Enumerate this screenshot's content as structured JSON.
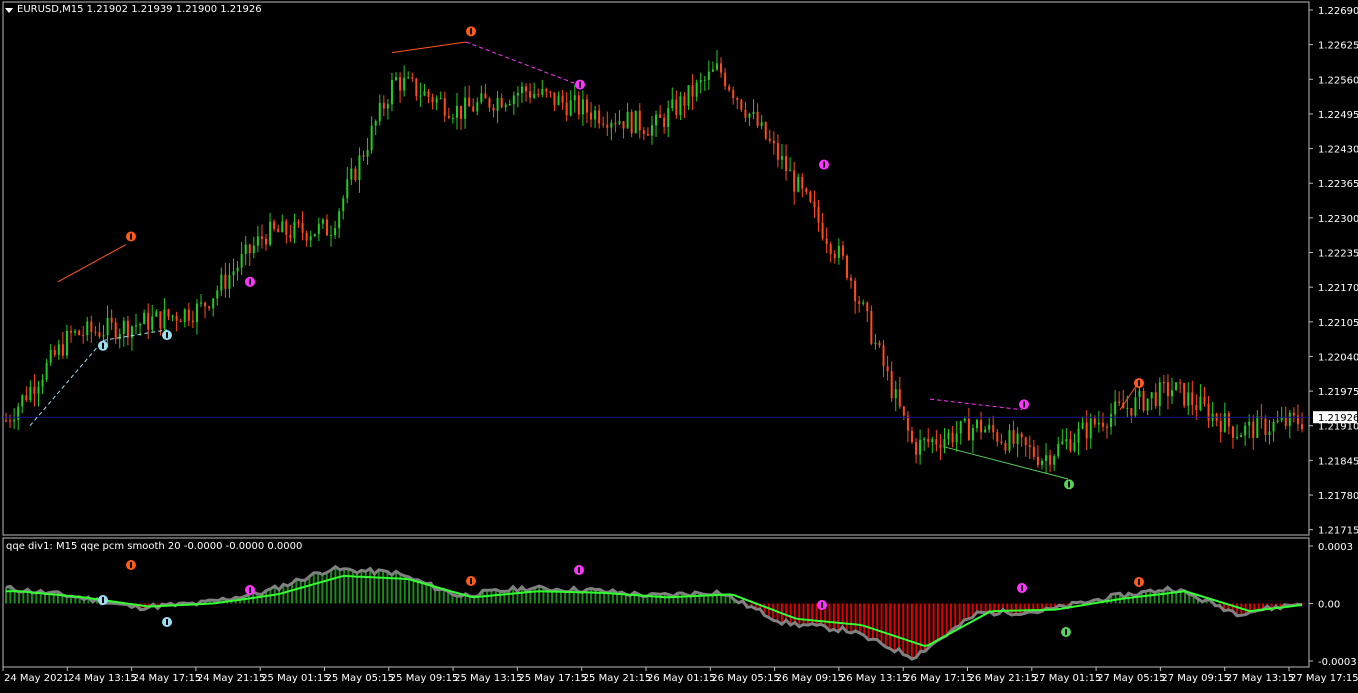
{
  "window": {
    "symbol_title": "EURUSD,M15  1.21902 1.21939 1.21900 1.21926",
    "menu_icon": "triangle-down-icon"
  },
  "price_axis": {
    "ticks": [
      "1.22690",
      "1.22625",
      "1.22560",
      "1.22495",
      "1.22430",
      "1.22365",
      "1.22300",
      "1.22235",
      "1.22170",
      "1.22105",
      "1.22040",
      "1.21975",
      "1.21910",
      "1.21845",
      "1.21780",
      "1.21715"
    ],
    "current_price_label": "1.21926",
    "current_price": 1.21926,
    "ylim": [
      1.21705,
      1.22705
    ]
  },
  "indicator": {
    "title": "qqe div1: M15 qqe pcm smooth  20 -0.0000 -0.0000 0.0000",
    "axis_ticks": [
      "0.0003",
      "0.00",
      "-0.0003"
    ]
  },
  "time_axis": {
    "labels": [
      "24 May 2021",
      "24 May 13:15",
      "24 May 17:15",
      "24 May 21:15",
      "25 May 01:15",
      "25 May 05:15",
      "25 May 09:15",
      "25 May 13:15",
      "25 May 17:15",
      "25 May 21:15",
      "26 May 01:15",
      "26 May 05:15",
      "26 May 09:15",
      "26 May 13:15",
      "26 May 17:15",
      "26 May 21:15",
      "27 May 01:15",
      "27 May 05:15",
      "27 May 09:15",
      "27 May 13:15",
      "27 May 17:15"
    ]
  },
  "colors": {
    "background": "#000000",
    "bull": "#22cc22",
    "bear": "#ff4a1a",
    "price_line": "#1a1a8c",
    "qqe_fast": "#33ff33",
    "qqe_slow": "#808080",
    "hist_pos": "#1a8a1a",
    "hist_neg": "#e00000",
    "div_bear": "#ff5a1a",
    "div_bear_hidden": "#ff33ff",
    "div_bull": "#5ad05a",
    "div_bull_hidden": "#9adcf0"
  },
  "chart_data": [
    {
      "type": "candlestick",
      "title": "EURUSD,M15",
      "ylim": [
        1.21705,
        1.22705
      ],
      "approximate_close_path": [
        {
          "x": "24 May 2021",
          "y": 1.2192
        },
        {
          "x": "24 May 13:15",
          "y": 1.2208
        },
        {
          "x": "24 May 17:15",
          "y": 1.221
        },
        {
          "x": "24 May 21:15",
          "y": 1.2213
        },
        {
          "x": "25 May 01:15",
          "y": 1.2227
        },
        {
          "x": "25 May 05:15",
          "y": 1.2228
        },
        {
          "x": "25 May 09:15",
          "y": 1.2256
        },
        {
          "x": "25 May 13:15",
          "y": 1.225
        },
        {
          "x": "25 May 17:15",
          "y": 1.2254
        },
        {
          "x": "25 May 21:15",
          "y": 1.225
        },
        {
          "x": "26 May 01:15",
          "y": 1.2247
        },
        {
          "x": "26 May 05:15",
          "y": 1.2258
        },
        {
          "x": "26 May 09:15",
          "y": 1.224
        },
        {
          "x": "26 May 13:15",
          "y": 1.222
        },
        {
          "x": "26 May 17:15",
          "y": 1.2187
        },
        {
          "x": "26 May 21:15",
          "y": 1.2191
        },
        {
          "x": "27 May 01:15",
          "y": 1.2185
        },
        {
          "x": "27 May 05:15",
          "y": 1.2193
        },
        {
          "x": "27 May 09:15",
          "y": 1.2198
        },
        {
          "x": "27 May 13:15",
          "y": 1.219
        },
        {
          "x": "27 May 17:15",
          "y": 1.2192
        }
      ]
    },
    {
      "type": "area",
      "title": "qqe div1: M15 qqe pcm smooth  20 -0.0000 -0.0000 0.0000",
      "ylim": [
        -0.0003,
        0.0003
      ],
      "approximate_values": [
        {
          "x": "24 May 2021",
          "y": 8e-05
        },
        {
          "x": "24 May 13:15",
          "y": 4e-05
        },
        {
          "x": "24 May 17:15",
          "y": -2e-05
        },
        {
          "x": "24 May 21:15",
          "y": 0.0
        },
        {
          "x": "25 May 01:15",
          "y": 6e-05
        },
        {
          "x": "25 May 05:15",
          "y": 0.00018
        },
        {
          "x": "25 May 09:15",
          "y": 0.00016
        },
        {
          "x": "25 May 13:15",
          "y": 4e-05
        },
        {
          "x": "25 May 17:15",
          "y": 8e-05
        },
        {
          "x": "25 May 21:15",
          "y": 7e-05
        },
        {
          "x": "26 May 01:15",
          "y": 4e-05
        },
        {
          "x": "26 May 05:15",
          "y": 6e-05
        },
        {
          "x": "26 May 09:15",
          "y": -0.0001
        },
        {
          "x": "26 May 13:15",
          "y": -0.00014
        },
        {
          "x": "26 May 17:15",
          "y": -0.00028
        },
        {
          "x": "26 May 21:15",
          "y": -5e-05
        },
        {
          "x": "27 May 01:15",
          "y": -4e-05
        },
        {
          "x": "27 May 05:15",
          "y": 3e-05
        },
        {
          "x": "27 May 09:15",
          "y": 8e-05
        },
        {
          "x": "27 May 13:15",
          "y": -5e-05
        },
        {
          "x": "27 May 17:15",
          "y": 0.0
        }
      ]
    }
  ]
}
